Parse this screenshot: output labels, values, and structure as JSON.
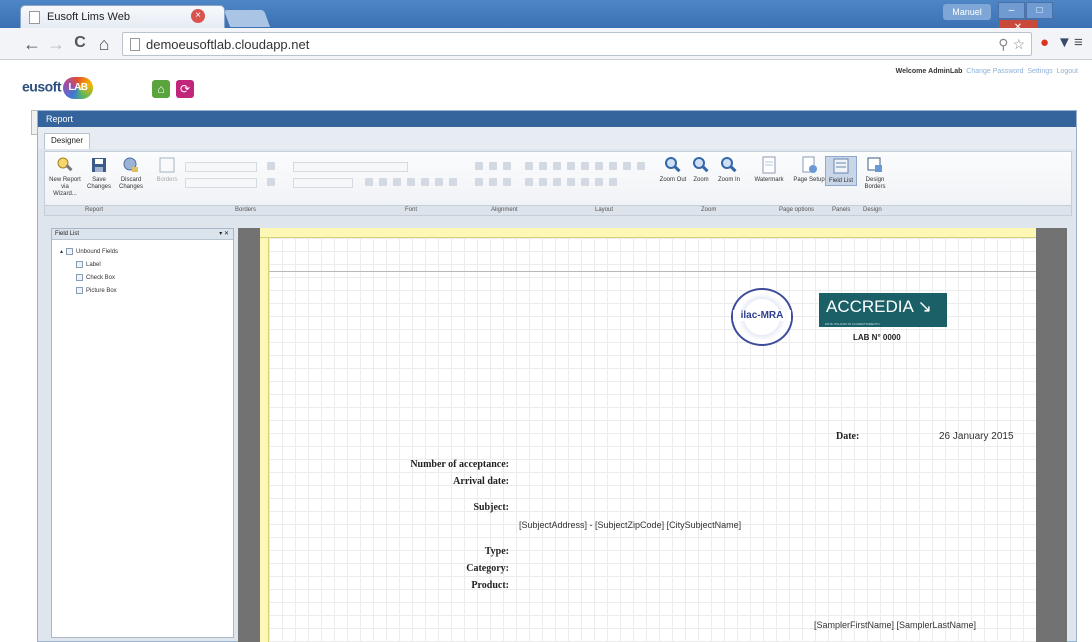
{
  "browser": {
    "tab_title": "Eusoft Lims Web",
    "tab_close": "×",
    "url": "demoeusoftlab.cloudapp.net",
    "nav_back": "←",
    "nav_forward": "→",
    "nav_reload": "C",
    "nav_home": "⌂",
    "menu": "≡",
    "user_badge": "Manuel",
    "win_min": "–",
    "win_max": "□",
    "win_close": "✕"
  },
  "app": {
    "logo_text": "eusoft",
    "logo_badge": "LAB",
    "welcome_label": "Welcome",
    "username": "AdminLab",
    "links": [
      "Change Password",
      "Settings",
      "Logout"
    ]
  },
  "panel": {
    "title": "Report",
    "tab_designer": "Designer"
  },
  "ribbon": {
    "buttons": [
      {
        "label": "New Report via Wizard...",
        "icon": "wizard-icon"
      },
      {
        "label": "Save Changes",
        "icon": "save-icon"
      },
      {
        "label": "Discard Changes",
        "icon": "discard-icon"
      },
      {
        "label": "Borders",
        "icon": "borders-icon"
      },
      {
        "label": "Zoom Out",
        "icon": "zoom-out-icon"
      },
      {
        "label": "Zoom",
        "icon": "zoom-icon"
      },
      {
        "label": "Zoom In",
        "icon": "zoom-in-icon"
      },
      {
        "label": "Watermark",
        "icon": "watermark-icon"
      },
      {
        "label": "Page Setup",
        "icon": "page-setup-icon"
      },
      {
        "label": "Field List",
        "icon": "field-list-icon"
      },
      {
        "label": "Design Borders",
        "icon": "design-borders-icon"
      }
    ],
    "groups": [
      "Report",
      "Borders",
      "Font",
      "Alignment",
      "Layout",
      "Zoom",
      "Page options",
      "Panels",
      "Design"
    ]
  },
  "field_list": {
    "title": "Field List",
    "pin": "▾ ✕",
    "root": "Unbound Fields",
    "items": [
      "Label",
      "Check Box",
      "Picture Box"
    ]
  },
  "report": {
    "ilac": "ilac-MRA",
    "accredia": "ACCREDIA",
    "accredia_sub": "ENTE ITALIANO DI ACCREDITAMENTO",
    "lab_number": "LAB N° 0000",
    "date_label": "Date:",
    "date_value": "26 January 2015",
    "acceptance_label": "Number of acceptance:",
    "arrival_label": "Arrival date:",
    "subject_label": "Subject:",
    "subject_value": "[SubjectAddress] - [SubjectZipCode] [CitySubjectName]",
    "type_label": "Type:",
    "category_label": "Category:",
    "product_label": "Product:",
    "sampler_value": "[SamplerFirstName] [SamplerLastName]"
  },
  "colors": {
    "panel_title_bg": "#34649b",
    "accredia_bg": "#1b5f67",
    "ruler": "#fdf7b6",
    "surface_bg": "#727272"
  }
}
